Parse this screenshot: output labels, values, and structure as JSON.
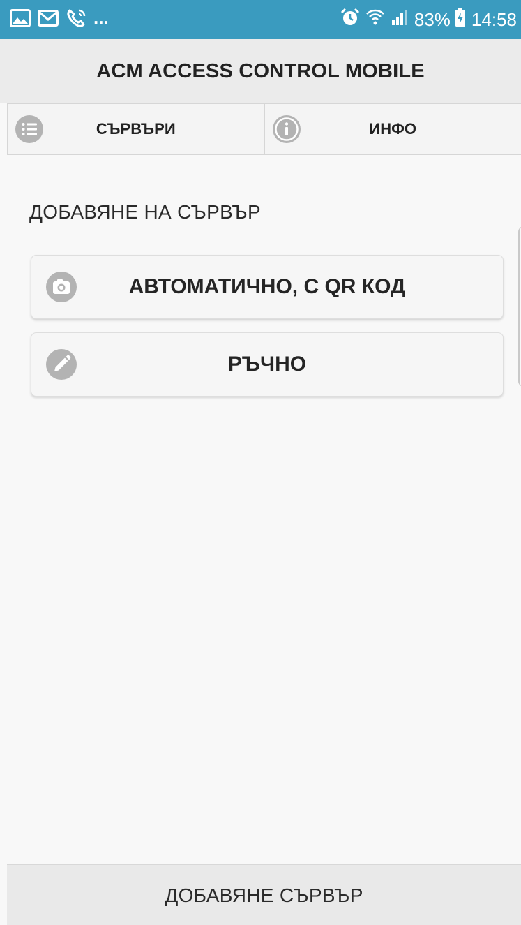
{
  "status_bar": {
    "left_icons": [
      "gallery-icon",
      "gmail-icon",
      "missed-call-icon"
    ],
    "ellipsis": "...",
    "right_icons": [
      "alarm-icon",
      "wifi-icon",
      "signal-icon"
    ],
    "battery_percent": "83%",
    "battery_icon": "battery-charging-icon",
    "time": "14:58",
    "background_color": "#3a9bbf"
  },
  "header": {
    "title": "ACM ACCESS CONTROL MOBILE"
  },
  "tabs": [
    {
      "label": "СЪРВЪРИ",
      "icon": "list-icon"
    },
    {
      "label": "ИНФО",
      "icon": "info-icon"
    }
  ],
  "main": {
    "section_heading": "ДОБАВЯНЕ НА СЪРВЪР",
    "options": [
      {
        "label": "АВТОМАТИЧНО, С QR КОД",
        "icon": "camera-icon"
      },
      {
        "label": "РЪЧНО",
        "icon": "pencil-icon"
      }
    ]
  },
  "footer": {
    "button_label": "ДОБАВЯНЕ СЪРВЪР"
  }
}
